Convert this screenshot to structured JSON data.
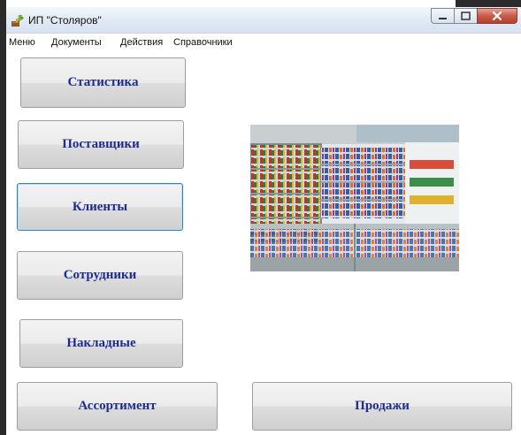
{
  "window": {
    "title": "ИП \"Столяров\""
  },
  "menu": [
    "Меню",
    "Документы",
    "Действия",
    "Справочники"
  ],
  "buttons": {
    "statistics": "Статистика",
    "suppliers": "Поставщики",
    "clients": "Клиенты",
    "employees": "Сотрудники",
    "invoices": "Накладные",
    "assortment": "Ассортимент",
    "sales": "Продажи"
  },
  "colors": {
    "button_text": "#1f2c8f",
    "focus_border": "#3c7fb1",
    "close_button": "#c75a48"
  },
  "icons": [
    "app-icon",
    "minimize-icon",
    "maximize-icon",
    "close-icon"
  ]
}
